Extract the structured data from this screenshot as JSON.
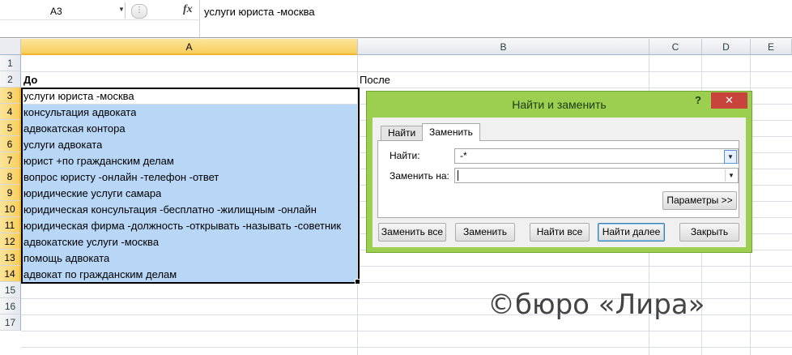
{
  "formula_bar": {
    "name_box": "A3",
    "fx_label": "fx",
    "formula": "услуги юриста -москва"
  },
  "columns": [
    "A",
    "B",
    "C",
    "D",
    "E"
  ],
  "rows": [
    "1",
    "2",
    "3",
    "4",
    "5",
    "6",
    "7",
    "8",
    "9",
    "10",
    "11",
    "12",
    "13",
    "14",
    "15",
    "16",
    "17"
  ],
  "cells": {
    "a2": "До",
    "b2": "После",
    "a_list": [
      "услуги юриста -москва",
      "консультация адвоката",
      "адвокатская контора",
      "услуги адвоката",
      "юрист +по гражданским делам",
      "вопрос юристу -онлайн -телефон -ответ",
      "юридические услуги самара",
      "юридическая консультация -бесплатно -жилищным -онлайн",
      "юридическая фирма -должность -открывать -называть -советник",
      "адвокатские услуги -москва",
      "помощь адвоката",
      "адвокат по гражданским делам"
    ]
  },
  "dialog": {
    "title": "Найти и заменить",
    "help": "?",
    "close": "✕",
    "tabs": [
      "Найти",
      "Заменить"
    ],
    "active_tab": "Заменить",
    "find_label": "Найти:",
    "find_value": "-*",
    "replace_label": "Заменить на:",
    "replace_value": "",
    "options_button": "Параметры >>",
    "buttons": [
      "Заменить все",
      "Заменить",
      "Найти все",
      "Найти далее",
      "Закрыть"
    ]
  },
  "watermark": "©бюро «Лира»",
  "colors": {
    "selection": "#b8d6f6",
    "header_selected": "#f7ce5e",
    "dialog_frame": "#9ccf50",
    "close_button": "#c7433b"
  }
}
